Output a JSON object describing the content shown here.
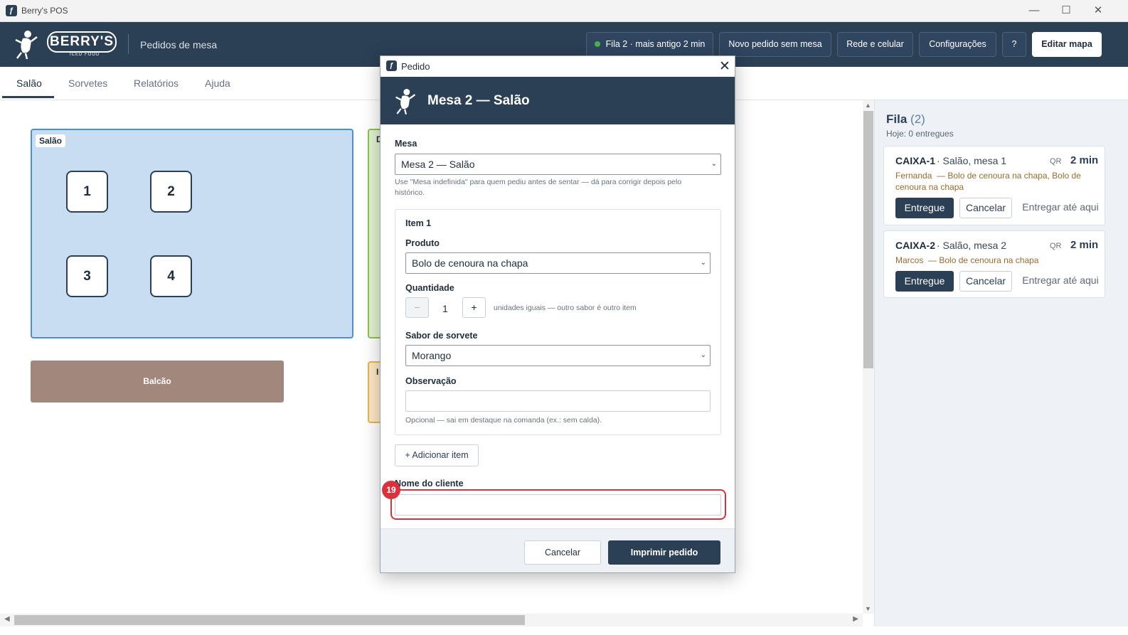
{
  "window": {
    "title": "Berry's POS",
    "app_icon": "app-logo-icon",
    "minimize": "—",
    "maximize": "☐",
    "close": "✕"
  },
  "header": {
    "brand": "BERRY'S",
    "brand_sub": "ICED FOOD",
    "subtitle": "Pedidos de mesa",
    "queue_status": "Fila 2 · mais antigo 2 min",
    "buttons": {
      "new_order": "Novo pedido sem mesa",
      "network": "Rede e celular",
      "settings": "Configurações",
      "help": "?",
      "edit_map": "Editar mapa"
    }
  },
  "tabs": [
    {
      "label": "Salão",
      "active": true
    },
    {
      "label": "Sorvetes",
      "active": false
    },
    {
      "label": "Relatórios",
      "active": false
    },
    {
      "label": "Ajuda",
      "active": false
    }
  ],
  "map": {
    "areas": [
      {
        "label": "Salão",
        "tables": [
          "1",
          "2",
          "3",
          "4"
        ]
      },
      {
        "label": "D"
      },
      {
        "label": "I"
      }
    ],
    "counter": "Balcão"
  },
  "queue": {
    "title": "Fila",
    "count": "(2)",
    "today": "Hoje: 0 entregues",
    "orders": [
      {
        "code": "CAIXA-1",
        "location": "· Salão, mesa 1",
        "source": "QR",
        "elapsed": "2 min",
        "customer": "Fernanda",
        "items": "— Bolo de cenoura na chapa, Bolo de cenoura na chapa",
        "actions": {
          "deliver": "Entregue",
          "cancel": "Cancelar",
          "deliver_here": "Entregar até aqui"
        }
      },
      {
        "code": "CAIXA-2",
        "location": "· Salão, mesa 2",
        "source": "QR",
        "elapsed": "2 min",
        "customer": "Marcos",
        "items": "— Bolo de cenoura na chapa",
        "actions": {
          "deliver": "Entregue",
          "cancel": "Cancelar",
          "deliver_here": "Entregar até aqui"
        }
      }
    ]
  },
  "dialog": {
    "window_title": "Pedido",
    "close": "✕",
    "heading": "Mesa 2 — Salão",
    "table_label": "Mesa",
    "table_value": "Mesa 2 — Salão",
    "table_hint": "Use \"Mesa indefinida\" para quem pediu antes de sentar — dá para corrigir depois pelo histórico.",
    "item": {
      "title": "Item 1",
      "product_label": "Produto",
      "product_value": "Bolo de cenoura na chapa",
      "qty_label": "Quantidade",
      "qty_minus": "−",
      "qty_value": "1",
      "qty_plus": "+",
      "qty_hint": "unidades iguais — outro sabor é outro item",
      "flavor_label": "Sabor de sorvete",
      "flavor_value": "Morango",
      "note_label": "Observação",
      "note_value": "",
      "note_hint": "Opcional — sai em destaque na comanda (ex.: sem calda)."
    },
    "add_item": "+ Adicionar item",
    "customer_label": "Nome do cliente",
    "customer_value": "",
    "highlight_badge": "19",
    "cancel": "Cancelar",
    "print": "Imprimir pedido"
  },
  "colors": {
    "navy": "#2b3f55",
    "salao_area": "#c8dcf2",
    "counter": "#a1877c",
    "highlight": "#d9323f"
  }
}
